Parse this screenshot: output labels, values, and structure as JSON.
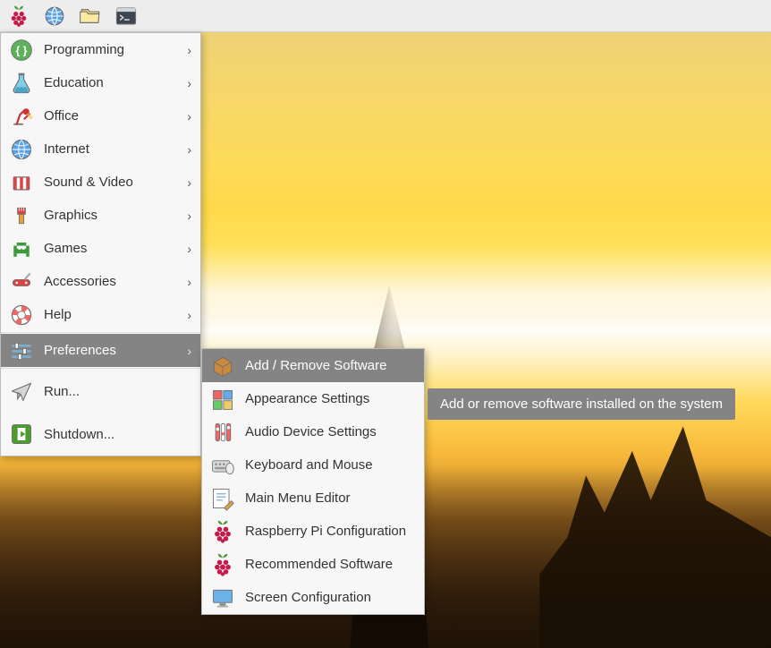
{
  "panel": {
    "launchers": [
      "raspberry-menu",
      "web-browser",
      "file-manager",
      "terminal"
    ]
  },
  "menu": {
    "items": [
      {
        "label": "Programming",
        "submenu": true,
        "icon": "braces-icon"
      },
      {
        "label": "Education",
        "submenu": true,
        "icon": "flask-icon"
      },
      {
        "label": "Office",
        "submenu": true,
        "icon": "lamp-icon"
      },
      {
        "label": "Internet",
        "submenu": true,
        "icon": "globe-icon"
      },
      {
        "label": "Sound & Video",
        "submenu": true,
        "icon": "clapper-icon"
      },
      {
        "label": "Graphics",
        "submenu": true,
        "icon": "brush-icon"
      },
      {
        "label": "Games",
        "submenu": true,
        "icon": "invader-icon"
      },
      {
        "label": "Accessories",
        "submenu": true,
        "icon": "knife-icon"
      },
      {
        "label": "Help",
        "submenu": true,
        "icon": "lifebuoy-icon"
      },
      {
        "label": "Preferences",
        "submenu": true,
        "icon": "sliders-icon",
        "selected": true
      },
      {
        "label": "Run...",
        "submenu": false,
        "icon": "paperplane-icon"
      },
      {
        "label": "Shutdown...",
        "submenu": false,
        "icon": "exit-icon"
      }
    ]
  },
  "submenu": {
    "items": [
      {
        "label": "Add / Remove Software",
        "icon": "package-icon",
        "selected": true
      },
      {
        "label": "Appearance Settings",
        "icon": "palette-icon"
      },
      {
        "label": "Audio Device Settings",
        "icon": "mixer-icon"
      },
      {
        "label": "Keyboard and Mouse",
        "icon": "keyboard-icon"
      },
      {
        "label": "Main Menu Editor",
        "icon": "editor-icon"
      },
      {
        "label": "Raspberry Pi Configuration",
        "icon": "raspberry-icon"
      },
      {
        "label": "Recommended Software",
        "icon": "raspberry-icon"
      },
      {
        "label": "Screen Configuration",
        "icon": "monitor-icon"
      }
    ]
  },
  "tooltip": "Add or remove software installed on the system"
}
